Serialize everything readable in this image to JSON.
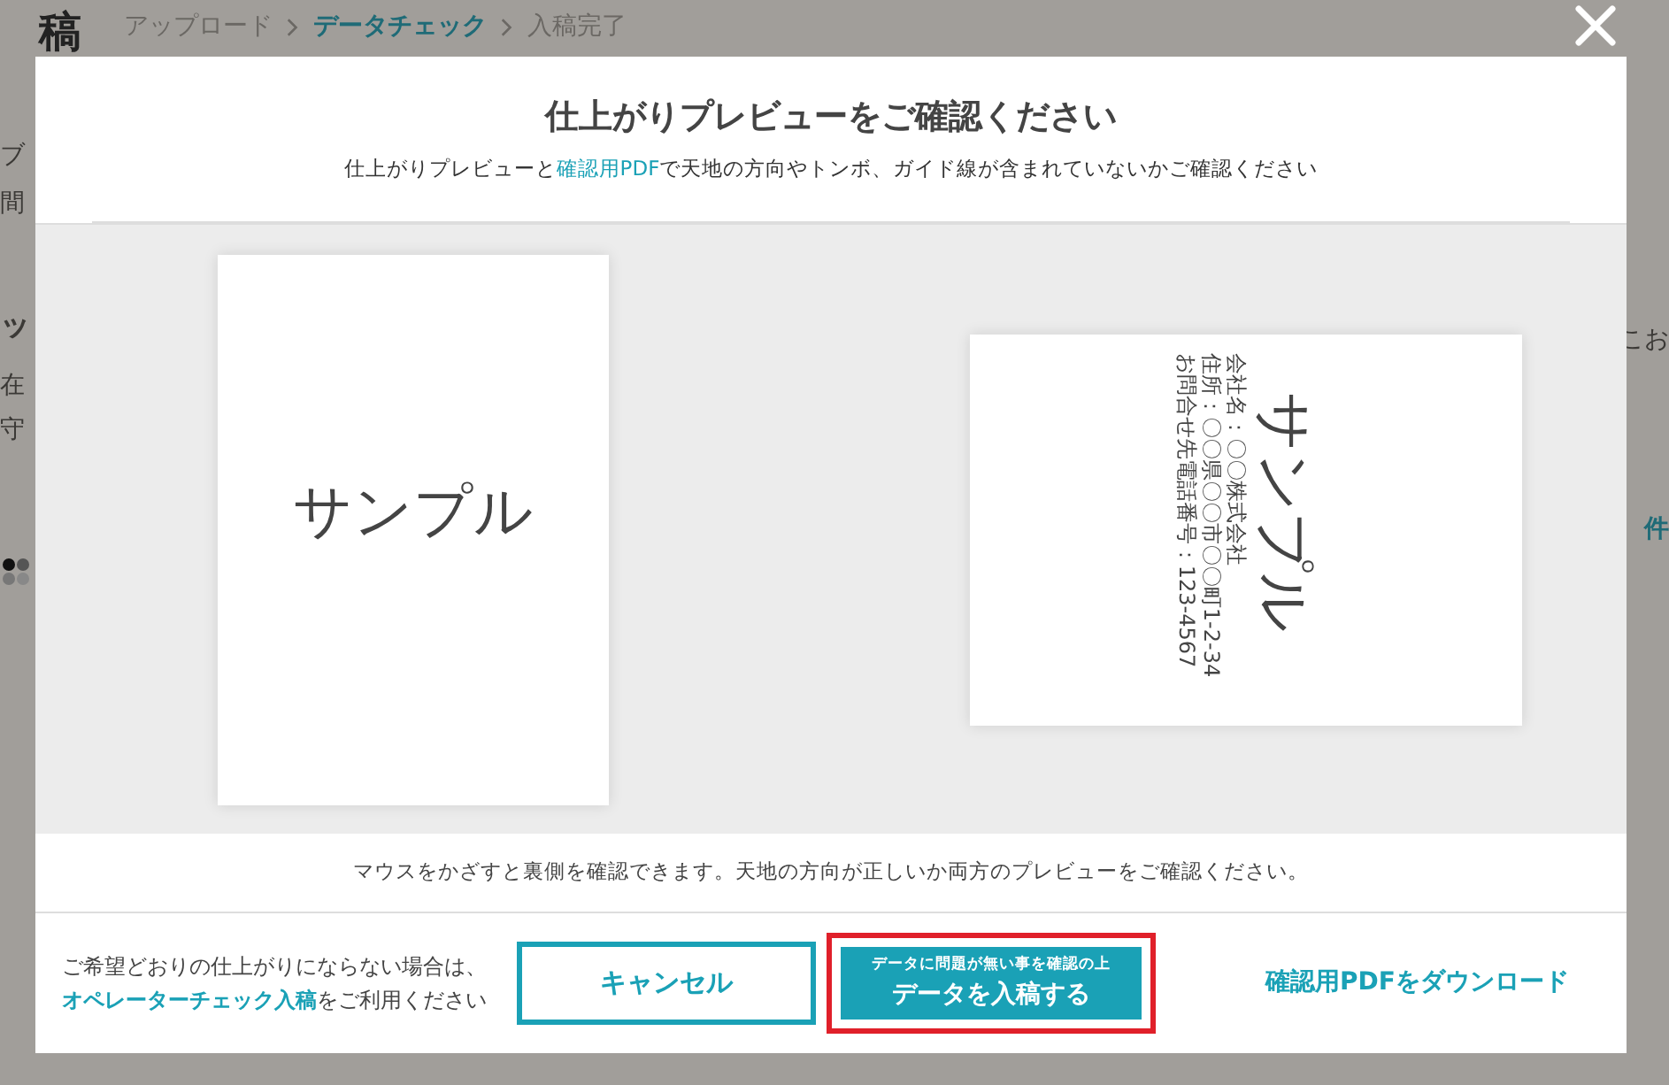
{
  "background_page": {
    "title": "稿",
    "breadcrumb": [
      {
        "label": "アップロード",
        "selected": false
      },
      {
        "label": "データチェック",
        "selected": true
      },
      {
        "label": "入稿完了",
        "selected": false
      }
    ],
    "left_fragments": [
      "ブ",
      "間",
      "ッ",
      "在",
      "守"
    ],
    "right_fragments": [
      "こお",
      "件"
    ]
  },
  "modal": {
    "title": "仕上がりプレビューをご確認ください",
    "subtitle_start": "仕上がりプレビューと",
    "subtitle_link": "確認用PDF",
    "subtitle_end": "で天地の方向やトンボ、ガイド線が含まれていないかご確認ください",
    "previews": [
      {
        "kind": "front",
        "text": "サンプル"
      },
      {
        "kind": "back",
        "text": "サンプル",
        "lines": [
          "会社名：〇〇株式会社",
          "住所：〇〇県〇〇市〇〇町1-2-34",
          "お問合せ先電話番号：123-4567"
        ]
      }
    ],
    "caption": "マウスをかざすと裏側を確認できます。天地の方向が正しいか両方のプレビューをご確認ください。",
    "footer": {
      "note_line1": "ご希望どおりの仕上がりにならない場合は、",
      "note_link": "オペレーターチェック入稿",
      "note_after": "をご利用ください",
      "cancel": "キャンセル",
      "submit_small": "データに問題が無い事を確認の上",
      "submit_main": "データを入稿する",
      "submit_highlighted": true,
      "download": "確認用PDFをダウンロード"
    }
  }
}
